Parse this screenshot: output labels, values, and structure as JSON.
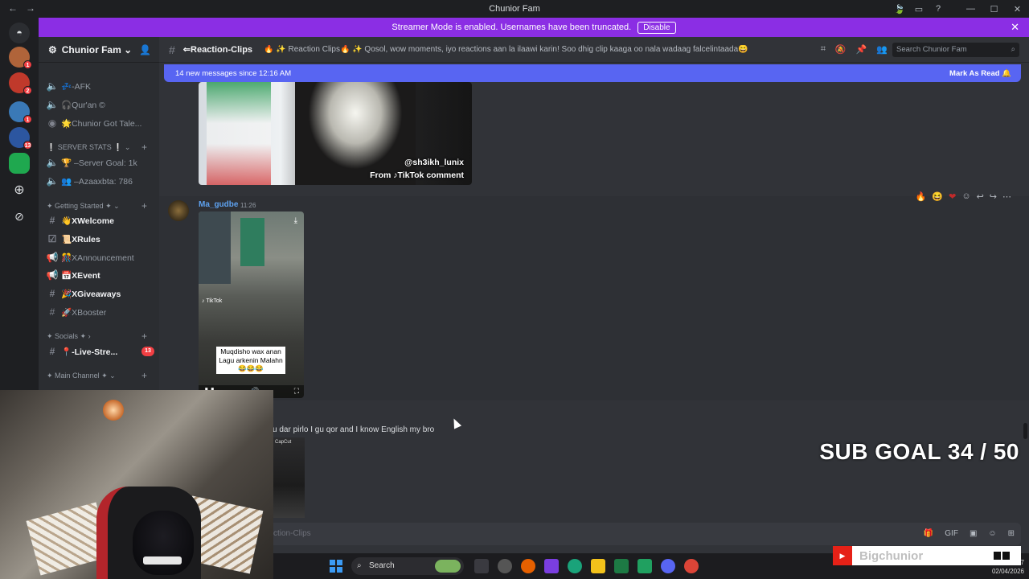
{
  "window": {
    "title": "Chunior Fam",
    "controls": [
      "—",
      "☐",
      "✕"
    ]
  },
  "banner": {
    "text": "Streamer Mode is enabled. Usernames have been truncated.",
    "button": "Disable",
    "close": "✕"
  },
  "servers": [
    {
      "badge": "1",
      "color": "#b0643a"
    },
    {
      "badge": "2",
      "color": "#c0392b"
    },
    {
      "badge": "1",
      "color": "#3a79b7"
    },
    {
      "badge": "13",
      "color": "#2c56a0"
    },
    {
      "badge": "",
      "color": "#1fa84f"
    }
  ],
  "sidebar": {
    "guild_name": "Chunior Fam ⌄",
    "channels": [
      {
        "icon": "🔈",
        "label": "💤-AFK",
        "bold": false
      },
      {
        "icon": "🔈",
        "label": "🎧Qur'an ©",
        "bold": false
      },
      {
        "icon": "◉",
        "label": "🌟Chunior Got Tale...",
        "bold": false
      },
      {
        "icon": "🔈",
        "label": "🏆 –Server Goal: 1k",
        "bold": false
      },
      {
        "icon": "🔈",
        "label": "👥 –Azaaxbta: 786",
        "bold": false
      },
      {
        "icon": "#",
        "label": "👋XWelcome",
        "bold": true
      },
      {
        "icon": "☑",
        "label": "📜XRules",
        "bold": true
      },
      {
        "icon": "📢",
        "label": "🎊XAnnouncement",
        "bold": false
      },
      {
        "icon": "📢",
        "label": "📅XEvent",
        "bold": true
      },
      {
        "icon": "#",
        "label": "🎉XGiveaways",
        "bold": true
      },
      {
        "icon": "#",
        "label": "🚀XBooster",
        "bold": false
      },
      {
        "icon": "#",
        "label": "📍-Live-Stre...",
        "bold": true,
        "badge": "13"
      }
    ],
    "categories": [
      "❕ SERVER STATS ❕ ⌄",
      "✦ Getting Started ✦ ⌄",
      "✦ Socials ✦ ›",
      "✦ Main Channel ✦ ⌄"
    ]
  },
  "channel": {
    "name": "⇐Reaction-Clips",
    "topic": "🔥 ✨ Reaction Clips🔥 ✨ Qosol, wow moments, iyo reactions aan la ilaawi karin! Soo dhig clip kaaga oo nala wadaag falcelintaada😄",
    "search_placeholder": "Search Chunior Fam"
  },
  "newmsgs": {
    "text": "14 new messages since 12:16 AM",
    "button": "Mark As Read"
  },
  "messages": [
    {
      "watermark1": "@sh3ikh_lunix",
      "watermark2": "From ♪TikTok comment"
    },
    {
      "author": "Ma_gudbe",
      "time": "11:26",
      "tiktok": "♪ TikTok",
      "caption": "Muqdisho wax anan Lagu arkenin Malahn😂😂😂"
    },
    {
      "text": "u dar pirlo I gu qor and I know English my bro",
      "clip_label": "CapCut"
    }
  ],
  "composer": {
    "placeholder": "Message #⇐Reaction-Clips",
    "visible_text": "ction-Clips"
  },
  "overlay": {
    "sub_goal": "SUB GOAL 34 / 50",
    "yt_name": "Bigchunior"
  },
  "taskbar": {
    "search": "Search",
    "time": "...57",
    "date": "02/04/2026"
  }
}
